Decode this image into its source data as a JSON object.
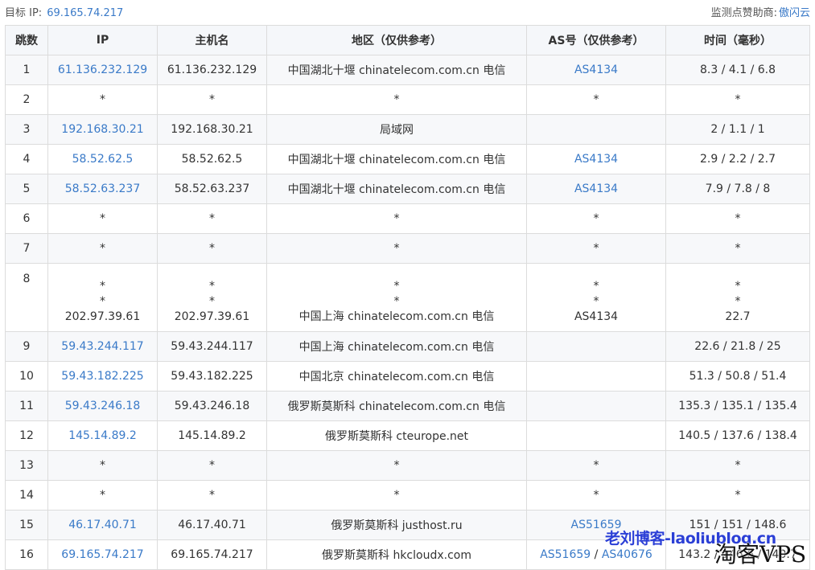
{
  "header": {
    "target_label": "目标 IP:",
    "target_ip": "69.165.74.217",
    "sponsor_label": "监测点赞助商:",
    "sponsor_name": "傲闪云"
  },
  "columns": [
    "跳数",
    "IP",
    "主机名",
    "地区（仅供参考）",
    "AS号（仅供参考）",
    "时间（毫秒）"
  ],
  "hops": [
    {
      "hop": "1",
      "ip": "61.136.232.129",
      "host": "61.136.232.129",
      "region": "中国湖北十堰 chinatelecom.com.cn 电信",
      "as1": "AS4134",
      "as2": "",
      "time": "8.3 / 4.1 / 6.8"
    },
    {
      "hop": "2",
      "ip": "*",
      "host": "*",
      "region": "*",
      "as1": "*",
      "as2": "",
      "time": "*"
    },
    {
      "hop": "3",
      "ip": "192.168.30.21",
      "host": "192.168.30.21",
      "region": "局域网",
      "as1": "",
      "as2": "",
      "time": "2 / 1.1 / 1"
    },
    {
      "hop": "4",
      "ip": "58.52.62.5",
      "host": "58.52.62.5",
      "region": "中国湖北十堰 chinatelecom.com.cn 电信",
      "as1": "AS4134",
      "as2": "",
      "time": "2.9 / 2.2 / 2.7"
    },
    {
      "hop": "5",
      "ip": "58.52.63.237",
      "host": "58.52.63.237",
      "region": "中国湖北十堰 chinatelecom.com.cn 电信",
      "as1": "AS4134",
      "as2": "",
      "time": "7.9 / 7.8 / 8"
    },
    {
      "hop": "6",
      "ip": "*",
      "host": "*",
      "region": "*",
      "as1": "*",
      "as2": "",
      "time": "*"
    },
    {
      "hop": "7",
      "ip": "*",
      "host": "*",
      "region": "*",
      "as1": "*",
      "as2": "",
      "time": "*"
    },
    {
      "hop": "8",
      "multi": true,
      "ip": [
        "*",
        "*",
        "202.97.39.61"
      ],
      "host": [
        "*",
        "*",
        "202.97.39.61"
      ],
      "region": [
        "*",
        "*",
        "中国上海 chinatelecom.com.cn 电信"
      ],
      "as1": [
        "*",
        "*",
        "AS4134"
      ],
      "time": [
        "*",
        "*",
        "22.7"
      ]
    },
    {
      "hop": "9",
      "ip": "59.43.244.117",
      "host": "59.43.244.117",
      "region": "中国上海 chinatelecom.com.cn 电信",
      "as1": "",
      "as2": "",
      "time": "22.6 / 21.8 / 25"
    },
    {
      "hop": "10",
      "ip": "59.43.182.225",
      "host": "59.43.182.225",
      "region": "中国北京 chinatelecom.com.cn 电信",
      "as1": "",
      "as2": "",
      "time": "51.3 / 50.8 / 51.4"
    },
    {
      "hop": "11",
      "ip": "59.43.246.18",
      "host": "59.43.246.18",
      "region": "俄罗斯莫斯科 chinatelecom.com.cn 电信",
      "as1": "",
      "as2": "",
      "time": "135.3 / 135.1 / 135.4"
    },
    {
      "hop": "12",
      "ip": "145.14.89.2",
      "host": "145.14.89.2",
      "region": "俄罗斯莫斯科 cteurope.net",
      "as1": "",
      "as2": "",
      "time": "140.5 / 137.6 / 138.4"
    },
    {
      "hop": "13",
      "ip": "*",
      "host": "*",
      "region": "*",
      "as1": "*",
      "as2": "",
      "time": "*"
    },
    {
      "hop": "14",
      "ip": "*",
      "host": "*",
      "region": "*",
      "as1": "*",
      "as2": "",
      "time": "*"
    },
    {
      "hop": "15",
      "ip": "46.17.40.71",
      "host": "46.17.40.71",
      "region": "俄罗斯莫斯科 justhost.ru",
      "as1": "AS51659",
      "as2": "",
      "time": "151 / 151 / 148.6"
    },
    {
      "hop": "16",
      "ip": "69.165.74.217",
      "host": "69.165.74.217",
      "region": "俄罗斯莫斯科 hkcloudx.com",
      "as1": "AS51659",
      "as2": "AS40676",
      "time": "143.2 / 146.6 / 140.7"
    }
  ],
  "watermark": {
    "blog": "老刘博客-laoliublog.cn",
    "brand": "淘客VPS"
  }
}
